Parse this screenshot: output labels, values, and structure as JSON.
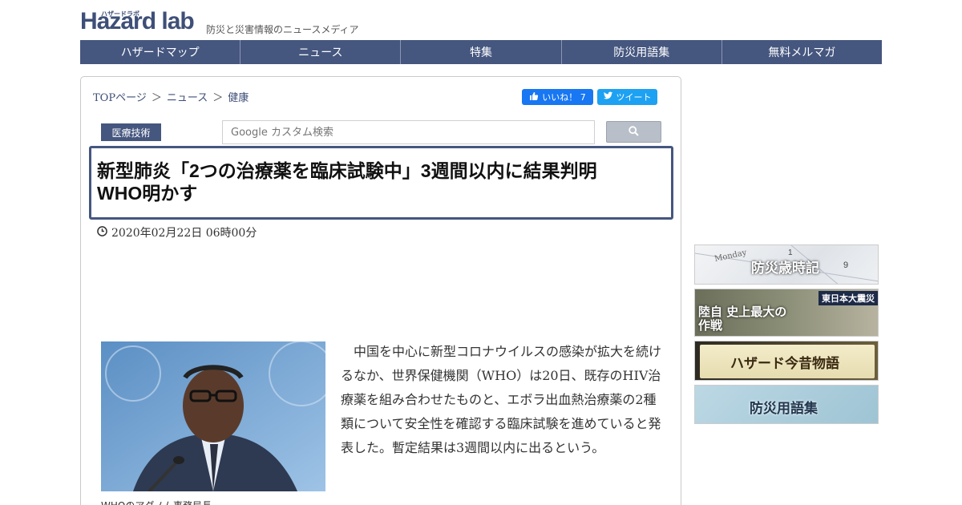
{
  "header": {
    "logo_text": "Hazard lab",
    "logo_kana": "ハザードラボ",
    "tagline": "防災と災害情報のニュースメディア"
  },
  "nav": {
    "items": [
      "ハザードマップ",
      "ニュース",
      "特集",
      "防災用語集",
      "無料メルマガ"
    ]
  },
  "breadcrumb": {
    "items": [
      "TOPページ",
      "ニュース",
      "健康"
    ],
    "separator": "＞"
  },
  "social": {
    "facebook_label": "いいね！ 7",
    "twitter_label": "ツイート"
  },
  "category_label": "医療技術",
  "search": {
    "placeholder": "Google カスタム検索"
  },
  "article": {
    "title_line1": "新型肺炎「2つの治療薬を臨床試験中」3週間以内に結果判明",
    "title_line2": "WHO明かす",
    "date": "2020年02月22日 06時00分",
    "body": "中国を中心に新型コロナウイルスの感染が拡大を続けるなか、世界保健機関（WHO）は20日、既存のHIV治療薬を組み合わせたものと、エボラ出血熱治療薬の2種類について安全性を確認する臨床試験を進めていると発表した。暫定結果は3週間以内に出るという。",
    "photo_caption": "WHOのアダノム事務局長"
  },
  "sidebar": {
    "banners": [
      {
        "label": "防災歳時記",
        "sub": "Monday"
      },
      {
        "label": "陸自 史上最大の作戦",
        "tag": "東日本大震災"
      },
      {
        "label": "ハザード今昔物語"
      },
      {
        "label": "防災用語集"
      }
    ]
  },
  "colors": {
    "brand": "#45567f",
    "facebook": "#1877f2",
    "twitter": "#1da1f2"
  }
}
